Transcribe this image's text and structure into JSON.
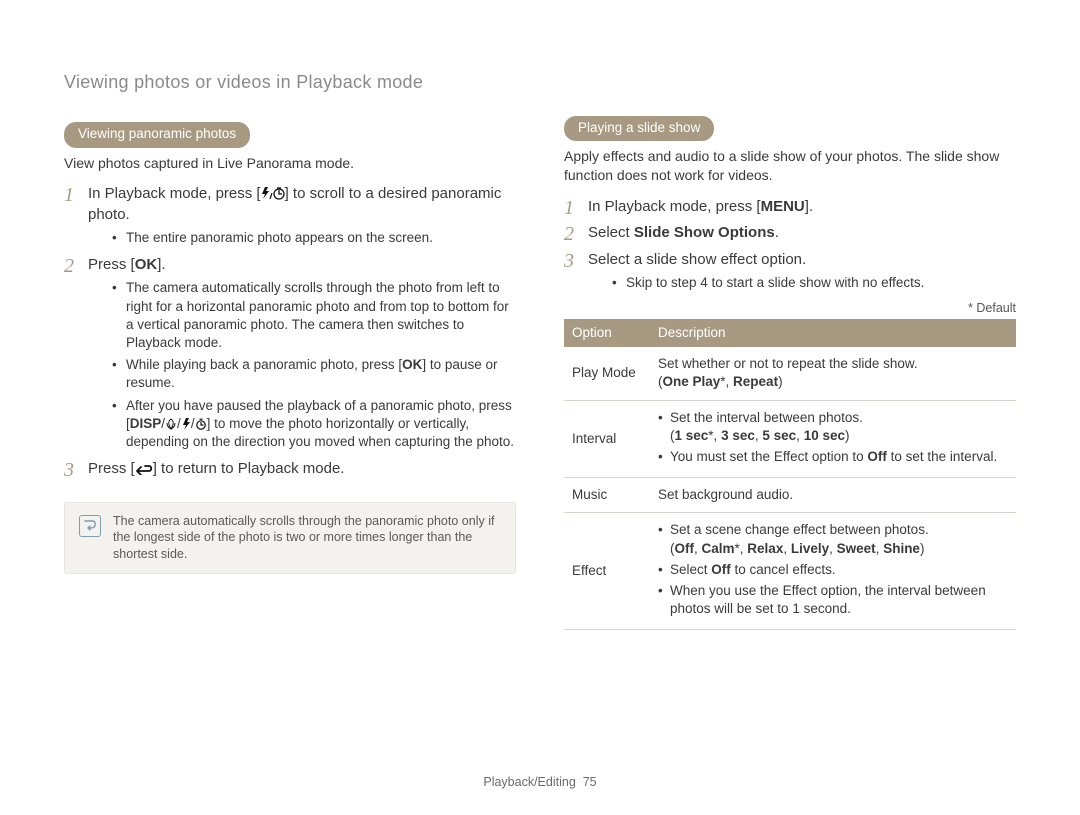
{
  "page_title": "Viewing photos or videos in Playback mode",
  "footer": {
    "section": "Playback/Editing",
    "page_num": "75"
  },
  "left": {
    "pill": "Viewing panoramic photos",
    "lead": "View photos captured in Live Panorama mode.",
    "step1_a": "In Playback mode, press [",
    "step1_b": "] to scroll to a desired panoramic photo.",
    "step1_sub1": "The entire panoramic photo appears on the screen.",
    "step2_a": "Press [",
    "step2_ok": "OK",
    "step2_b": "].",
    "step2_sub1": "The camera automatically scrolls through the photo from left to right for a horizontal panoramic photo and from top to bottom for a vertical panoramic photo. The camera then switches to Playback mode.",
    "step2_sub2_a": "While playing back a panoramic photo, press [",
    "step2_sub2_ok": "OK",
    "step2_sub2_b": "] to pause or resume.",
    "step2_sub3_a": "After you have paused the playback of a panoramic photo, press [",
    "step2_sub3_disp": "DISP",
    "step2_sub3_b": "] to move the photo horizontally or vertically, depending on the direction you moved when capturing the photo.",
    "step3_a": "Press [",
    "step3_b": "] to return to Playback mode.",
    "note": "The camera automatically scrolls through the panoramic photo only if the longest side of the photo is two or more times longer than the shortest side."
  },
  "right": {
    "pill": "Playing a slide show",
    "lead": "Apply effects and audio to a slide show of your photos. The slide show function does not work for videos.",
    "step1_a": "In Playback mode, press [",
    "step1_menu": "MENU",
    "step1_b": "].",
    "step2_a": "Select ",
    "step2_bold": "Slide Show Options",
    "step2_b": ".",
    "step3": "Select a slide show effect option.",
    "step3_sub1": "Skip to step 4 to start a slide show with no effects.",
    "default_tag": "* Default",
    "table": {
      "head_option": "Option",
      "head_desc": "Description",
      "rows": [
        {
          "option": "Play Mode",
          "desc_plain": "Set whether or not to repeat the slide show.",
          "desc_bold": "(One Play*, Repeat)"
        },
        {
          "option": "Interval",
          "b1": "Set the interval between photos.",
          "bold": "(1 sec*, 3 sec, 5 sec, 10 sec)",
          "b2a": "You must set the Effect option to ",
          "b2_off": "Off",
          "b2b": " to set the interval."
        },
        {
          "option": "Music",
          "desc_plain": "Set background audio."
        },
        {
          "option": "Effect",
          "b1": "Set a scene change effect between photos.",
          "bold": "(Off, Calm*, Relax, Lively, Sweet, Shine)",
          "b2a": "Select ",
          "b2_off": "Off",
          "b2b": " to cancel effects.",
          "b3": "When you use the Effect option, the interval between photos will be set to 1 second."
        }
      ]
    }
  }
}
